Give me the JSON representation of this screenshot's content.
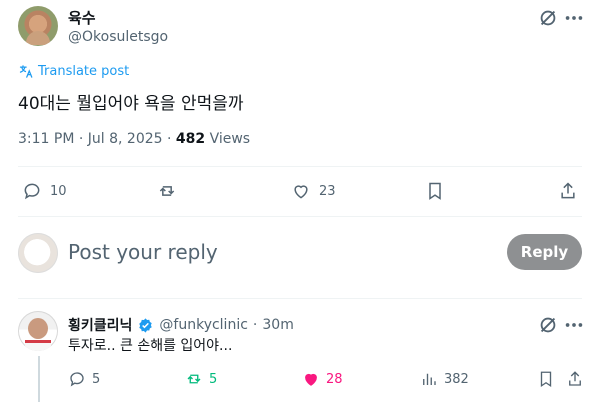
{
  "post": {
    "author_name": "육수",
    "author_handle": "@Okosuletsgo",
    "translate_label": "Translate post",
    "text": "40대는 뭘입어야 욕을 안먹을까",
    "time_date": "3:11 PM · Jul 8, 2025 · ",
    "views_count": "482",
    "views_label": " Views"
  },
  "actions": {
    "replies": "10",
    "likes": "23"
  },
  "reply_box": {
    "placeholder": "Post your reply",
    "button_label": "Reply",
    "button_color": "#8e9092"
  },
  "comment": {
    "author_name": "횡키클리닉",
    "author_handle": "@funkyclinic",
    "separator": "·",
    "time": "30m",
    "text": "투자로.. 큰 손해를 입어야...",
    "replies": "5",
    "reposts": "5",
    "likes": "28",
    "views": "382",
    "repost_color": "#00ba7c",
    "like_color": "#f91880",
    "verified_color": "#1d9bf0"
  }
}
